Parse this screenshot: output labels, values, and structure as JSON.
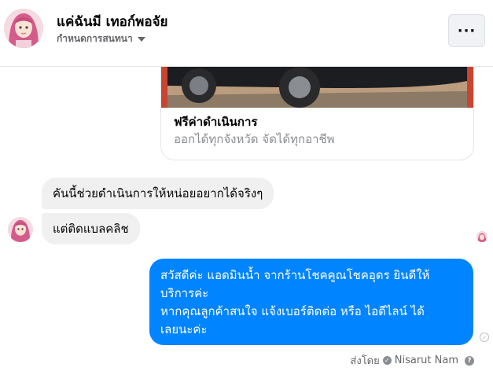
{
  "header": {
    "contact_name": "แค่ฉันมี เทอก์พอจัย",
    "settings_label": "กำหนดการสนทนา",
    "more_label": "···"
  },
  "card": {
    "title": "ฟรีค่าดำเนินการ",
    "subtitle": "ออกได้ทุกจังหวัด จัดได้ทุกอาชีพ"
  },
  "messages": {
    "incoming_1": "คันนี้ช่วยดำเนินการให้หน่อยอยากได้จริงๆ",
    "incoming_2": "แต่ติดแบลคลิช",
    "outgoing_lines": [
      "สวัสดีค่ะ แอดมินน้ำ จากร้านโชคคูณโชคอุดร ยินดีให้",
      "บริการค่ะ",
      "หากคุณลูกค้าสนใจ แจ้งเบอร์ติดต่อ หรือ ไอดีไลน์ ได้",
      "เลยนะค่ะ"
    ]
  },
  "footer": {
    "sent_by_label": "ส่งโดย",
    "sender_name": "Nisarut Nam"
  },
  "colors": {
    "outgoing_bubble": "#0084ff",
    "incoming_bubble": "#f0f0f0",
    "secondary_text": "#65676b"
  },
  "icons": [
    "more-icon",
    "chevron-down-icon",
    "check-circle-icon",
    "verified-icon",
    "help-icon"
  ]
}
